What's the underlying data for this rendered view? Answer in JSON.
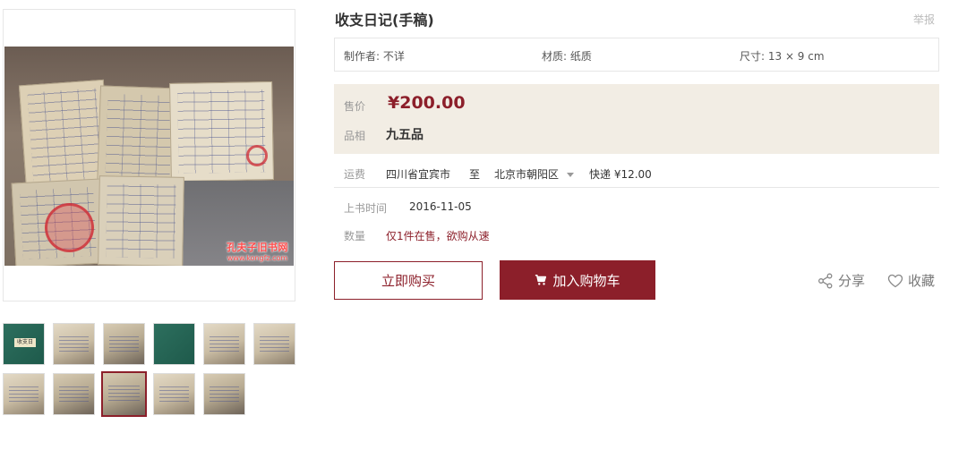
{
  "product": {
    "title": "收支日记(手稿)",
    "report_label": "举报"
  },
  "attributes": [
    {
      "label": "制作者: 不详"
    },
    {
      "label": "材质: 纸质"
    },
    {
      "label": "尺寸: 13 × 9 cm"
    }
  ],
  "pricing": {
    "price_label": "售价",
    "price_value": "¥200.00",
    "grade_label": "品相",
    "grade_value": "九五品"
  },
  "shipping": {
    "label": "运费",
    "from": "四川省宜宾市",
    "to_label": "至",
    "to": "北京市朝阳区",
    "method": "快递 ¥12.00"
  },
  "listing": {
    "date_label": "上书时间",
    "date_value": "2016-11-05",
    "qty_label": "数量",
    "qty_value": "仅1件在售，欲购从速"
  },
  "actions": {
    "buy_now": "立即购买",
    "add_to_cart": "加入购物车",
    "share": "分享",
    "favorite": "收藏"
  },
  "gallery": {
    "watermark_line1": "孔夫子旧书网",
    "watermark_line2": "www.kongfz.com",
    "thumb1_label": "收支日",
    "selected_index": 8
  },
  "colors": {
    "accent": "#8c1f2a",
    "price_bg": "#f2ede4"
  }
}
